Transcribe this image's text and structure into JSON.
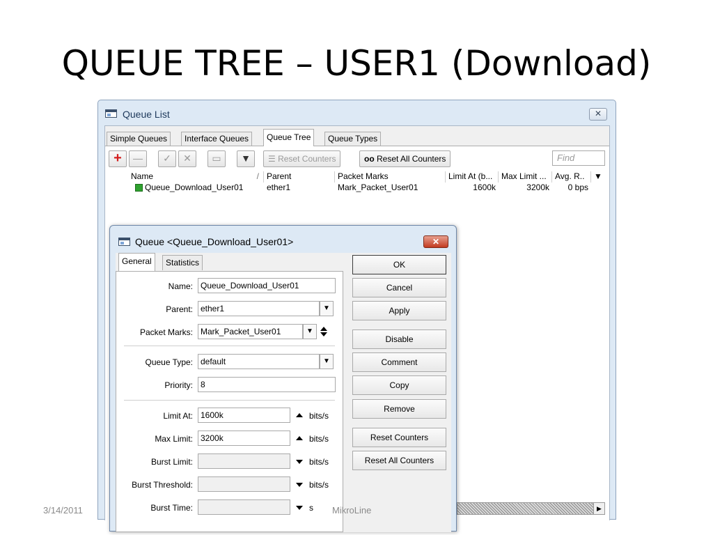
{
  "slide": {
    "title": "QUEUE TREE – USER1 (Download)",
    "date": "3/14/2011",
    "footer": "MikroLine"
  },
  "window": {
    "title": "Queue List",
    "close_glyph": "✕",
    "tabs": [
      "Simple Queues",
      "Interface Queues",
      "Queue Tree",
      "Queue Types"
    ],
    "active_tab": "Queue Tree",
    "toolbar": {
      "add_glyph": "+",
      "remove_glyph": "—",
      "enable_glyph": "✓",
      "disable_glyph": "✕",
      "comment_glyph": "▭",
      "filter_glyph": "▼",
      "reset_counters": "Reset Counters",
      "reset_all_prefix": "oo",
      "reset_all_counters": "Reset All Counters",
      "find_placeholder": "Find"
    },
    "columns": [
      "Name",
      "Parent",
      "Packet Marks",
      "Limit At (b...",
      "Max Limit ...",
      "Avg. R.."
    ],
    "sort_glyph": "/",
    "menu_glyph": "▼",
    "rows": [
      {
        "name": "Queue_Download_User01",
        "parent": "ether1",
        "packet_marks": "Mark_Packet_User01",
        "limit_at": "1600k",
        "max_limit": "3200k",
        "avg_rate": "0 bps"
      }
    ],
    "scroll_right_glyph": "▶"
  },
  "dialog": {
    "title": "Queue <Queue_Download_User01>",
    "close_glyph": "✕",
    "tabs": [
      "General",
      "Statistics"
    ],
    "fields": {
      "name_label": "Name:",
      "name_value": "Queue_Download_User01",
      "parent_label": "Parent:",
      "parent_value": "ether1",
      "packet_marks_label": "Packet Marks:",
      "packet_marks_value": "Mark_Packet_User01",
      "queue_type_label": "Queue Type:",
      "queue_type_value": "default",
      "priority_label": "Priority:",
      "priority_value": "8",
      "limit_at_label": "Limit At:",
      "limit_at_value": "1600k",
      "max_limit_label": "Max Limit:",
      "max_limit_value": "3200k",
      "burst_limit_label": "Burst Limit:",
      "burst_threshold_label": "Burst Threshold:",
      "burst_time_label": "Burst Time:",
      "unit_bits": "bits/s",
      "unit_s": "s"
    },
    "dropdown_glyph": "▼",
    "buttons": [
      "OK",
      "Cancel",
      "Apply",
      "Disable",
      "Comment",
      "Copy",
      "Remove",
      "Reset Counters",
      "Reset All Counters"
    ]
  },
  "colors": {
    "window_frame": "#dde9f5",
    "close_red": "#c23a1f",
    "add_red": "#d31f1f",
    "queue_icon_green": "#2fa12f"
  }
}
